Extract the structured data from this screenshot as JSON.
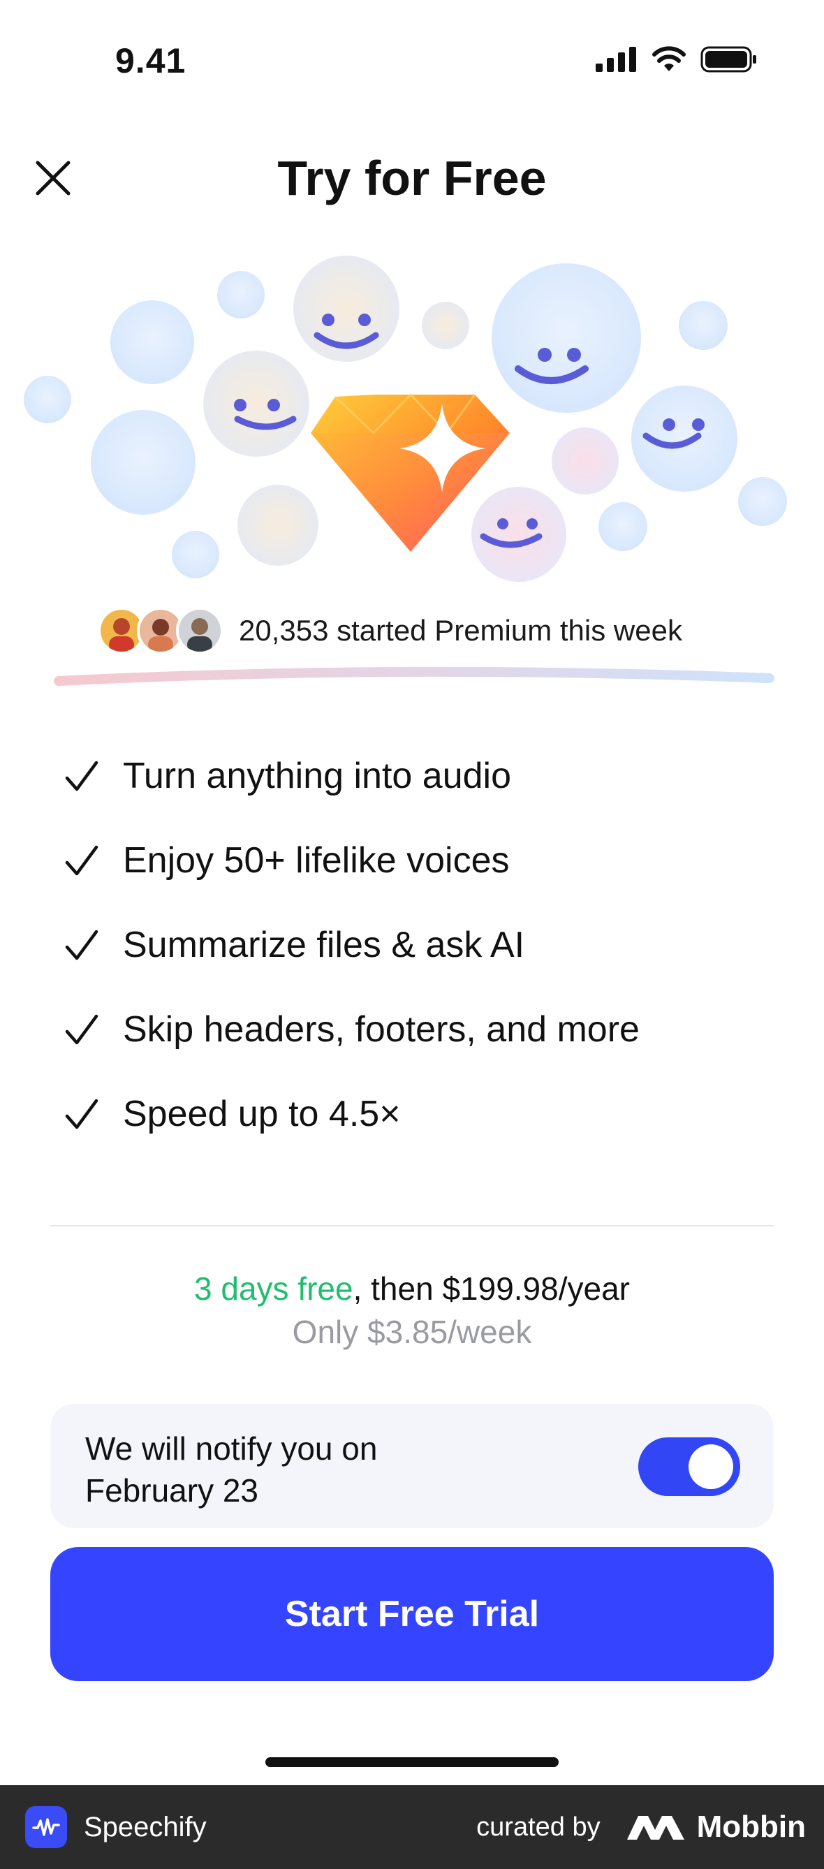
{
  "status_bar": {
    "time": "9.41"
  },
  "header": {
    "title": "Try for Free"
  },
  "social_proof": {
    "text": "20,353 started Premium this week"
  },
  "features": [
    "Turn anything into audio",
    "Enjoy 50+ lifelike voices",
    "Summarize files & ask AI",
    "Skip headers, footers, and more",
    "Speed up to 4.5×"
  ],
  "pricing": {
    "free_label": "3 days free",
    "then_label": ", then $199.98/year",
    "weekly_label": "Only $3.85/week"
  },
  "notify": {
    "label": "We will notify you on February 23",
    "enabled": true
  },
  "cta": {
    "label": "Start Free Trial"
  },
  "footer": {
    "brand": "Speechify",
    "curated_by": "curated by",
    "curator": "Mobbin"
  },
  "colors": {
    "accent": "#3444FF",
    "free_green": "#1FBD6E",
    "muted": "#9A9AA2"
  }
}
